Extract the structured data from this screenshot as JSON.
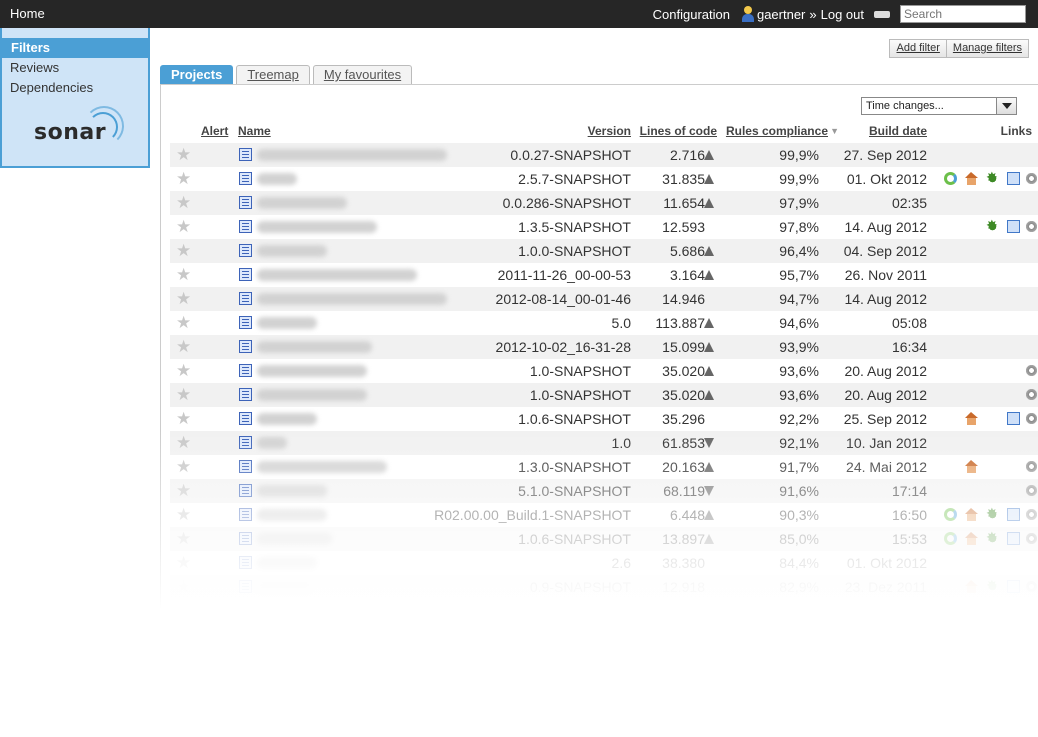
{
  "topbar": {
    "home_label": "Home",
    "configuration_label": "Configuration",
    "username": "gaertner",
    "separator": "»",
    "logout_label": "Log out",
    "search_placeholder": "Search"
  },
  "sidebar": {
    "filters_label": "Filters",
    "items": [
      {
        "label": "Reviews"
      },
      {
        "label": "Dependencies"
      }
    ],
    "logo_text": "sonar"
  },
  "filter_actions": {
    "add_filter": "Add filter",
    "manage_filters": "Manage filters"
  },
  "tabs": [
    {
      "label": "Projects",
      "active": true
    },
    {
      "label": "Treemap",
      "active": false
    },
    {
      "label": "My favourites",
      "active": false
    }
  ],
  "time_select": {
    "selected": "Time changes..."
  },
  "table": {
    "headers": {
      "alert": "Alert",
      "name": "Name",
      "version": "Version",
      "lines_of_code": "Lines of code",
      "rules_compliance": "Rules compliance",
      "build_date": "Build date",
      "links": "Links"
    },
    "sort_indicator": "▼",
    "rows": [
      {
        "version": "0.0.27-SNAPSHOT",
        "loc": "2.716",
        "trend": "up",
        "rules": "99,9%",
        "date": "27. Sep 2012",
        "links": []
      },
      {
        "version": "2.5.7-SNAPSHOT",
        "loc": "31.835",
        "trend": "up",
        "rules": "99,9%",
        "date": "01. Okt 2012",
        "links": [
          "ci",
          "home",
          "bug",
          "page",
          "gear"
        ]
      },
      {
        "version": "0.0.286-SNAPSHOT",
        "loc": "11.654",
        "trend": "up",
        "rules": "97,9%",
        "date": "02:35",
        "links": []
      },
      {
        "version": "1.3.5-SNAPSHOT",
        "loc": "12.593",
        "trend": "",
        "rules": "97,8%",
        "date": "14. Aug 2012",
        "links": [
          "bug",
          "page",
          "gear"
        ]
      },
      {
        "version": "1.0.0-SNAPSHOT",
        "loc": "5.686",
        "trend": "up",
        "rules": "96,4%",
        "date": "04. Sep 2012",
        "links": []
      },
      {
        "version": "2011-11-26_00-00-53",
        "loc": "3.164",
        "trend": "up",
        "rules": "95,7%",
        "date": "26. Nov 2011",
        "links": []
      },
      {
        "version": "2012-08-14_00-01-46",
        "loc": "14.946",
        "trend": "",
        "rules": "94,7%",
        "date": "14. Aug 2012",
        "links": []
      },
      {
        "version": "5.0",
        "loc": "113.887",
        "trend": "up",
        "rules": "94,6%",
        "date": "05:08",
        "links": []
      },
      {
        "version": "2012-10-02_16-31-28",
        "loc": "15.099",
        "trend": "up",
        "rules": "93,9%",
        "date": "16:34",
        "links": []
      },
      {
        "version": "1.0-SNAPSHOT",
        "loc": "35.020",
        "trend": "up",
        "rules": "93,6%",
        "date": "20. Aug 2012",
        "links": [
          "gear"
        ]
      },
      {
        "version": "1.0-SNAPSHOT",
        "loc": "35.020",
        "trend": "up",
        "rules": "93,6%",
        "date": "20. Aug 2012",
        "links": [
          "gear"
        ]
      },
      {
        "version": "1.0.6-SNAPSHOT",
        "loc": "35.296",
        "trend": "",
        "rules": "92,2%",
        "date": "25. Sep 2012",
        "links": [
          "home",
          "page",
          "gear"
        ]
      },
      {
        "version": "1.0",
        "loc": "61.853",
        "trend": "down",
        "rules": "92,1%",
        "date": "10. Jan 2012",
        "links": []
      },
      {
        "version": "1.3.0-SNAPSHOT",
        "loc": "20.163",
        "trend": "up",
        "rules": "91,7%",
        "date": "24. Mai 2012",
        "links": [
          "home",
          "gear"
        ]
      },
      {
        "version": "5.1.0-SNAPSHOT",
        "loc": "68.119",
        "trend": "down",
        "rules": "91,6%",
        "date": "17:14",
        "links": [
          "gear"
        ]
      },
      {
        "version": "R02.00.00_Build.1-SNAPSHOT",
        "loc": "6.448",
        "trend": "up",
        "rules": "90,3%",
        "date": "16:50",
        "links": [
          "ci",
          "home",
          "bug",
          "page",
          "gear"
        ]
      },
      {
        "version": "1.0.6-SNAPSHOT",
        "loc": "13.897",
        "trend": "up",
        "rules": "85,0%",
        "date": "15:53",
        "links": [
          "ci",
          "home",
          "bug",
          "page",
          "gear"
        ]
      },
      {
        "version": "2.6",
        "loc": "38.380",
        "trend": "",
        "rules": "84,4%",
        "date": "01. Okt 2012",
        "links": []
      },
      {
        "version": "0.9-SNAPSHOT",
        "loc": "12.918",
        "trend": "",
        "rules": "82,9%",
        "date": "23. Dez 2011",
        "links": [
          "home",
          "bug",
          "page",
          "gear"
        ]
      }
    ]
  }
}
